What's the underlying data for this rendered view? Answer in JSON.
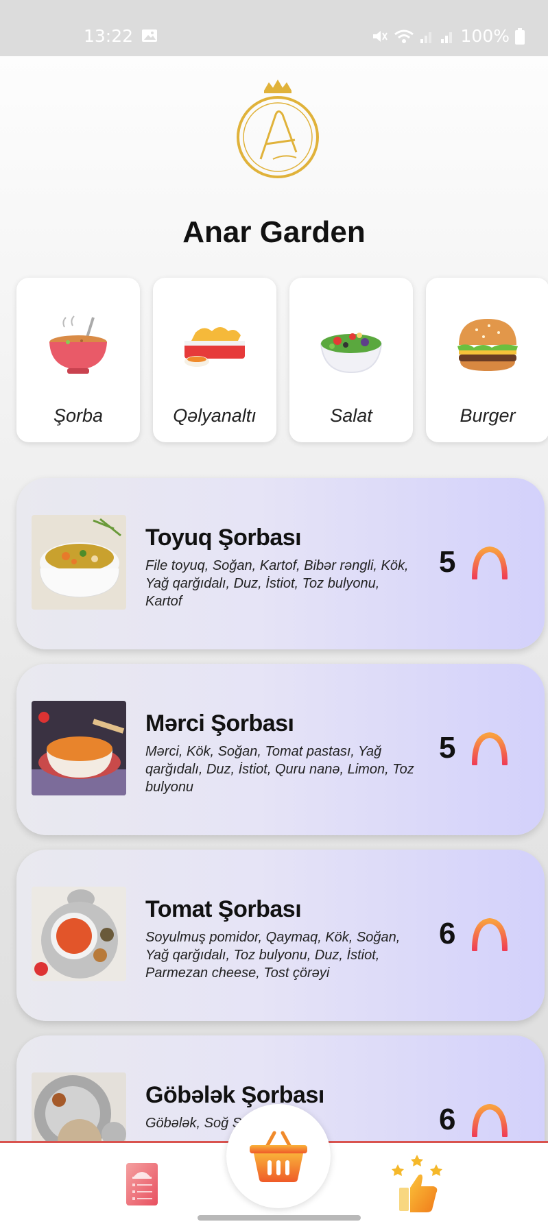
{
  "status_bar": {
    "time": "13:22",
    "battery": "100%"
  },
  "brand": {
    "name": "Anar Garden"
  },
  "categories": [
    {
      "label": "Şorba",
      "icon": "soup-bowl-icon"
    },
    {
      "label": "Qəlyanaltı",
      "icon": "snack-platter-icon"
    },
    {
      "label": "Salat",
      "icon": "salad-bowl-icon"
    },
    {
      "label": "Burger",
      "icon": "burger-icon"
    }
  ],
  "menu_items": [
    {
      "name": "Toyuq Şorbası",
      "description": "File toyuq, Soğan, Kartof, Bibər rəngli, Kök, Yağ qarğıdalı, Duz, İstiot, Toz bulyonu, Kartof",
      "price": "5",
      "currency_icon": "manat-icon"
    },
    {
      "name": "Mərci Şorbası",
      "description": "Mərci, Kök, Soğan, Tomat pastası, Yağ qarğıdalı, Duz, İstiot, Quru nanə, Limon, Toz bulyonu",
      "price": "5",
      "currency_icon": "manat-icon"
    },
    {
      "name": "Tomat Şorbası",
      "description": "Soyulmuş pomidor, Qaymaq, Kök, Soğan, Yağ qarğıdalı, Toz bulyonu, Duz, İstiot, Parmezan cheese, Tost çörəyi",
      "price": "6",
      "currency_icon": "manat-icon"
    },
    {
      "name": "Göbələk Şorbası",
      "description": "Göbələk, Soğ Süd, Yağ",
      "price": "6",
      "currency_icon": "manat-icon"
    }
  ],
  "bottom_nav": {
    "left_icon": "menu-book-icon",
    "center_icon": "shopping-basket-icon",
    "right_icon": "thumbs-up-stars-icon"
  },
  "colors": {
    "accent_red": "#d9534f",
    "manat_gradient_top": "#f9a03f",
    "manat_gradient_bottom": "#ef3e55",
    "card_gradient_end": "#d3d1fb",
    "logo_gold": "#e0b23a"
  }
}
